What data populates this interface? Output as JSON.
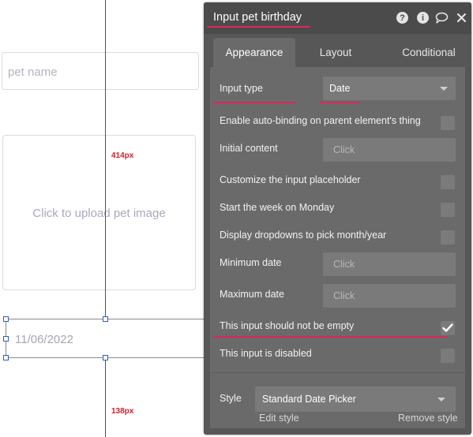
{
  "canvas": {
    "pet_name_placeholder": "pet name",
    "upload_image_text": "Click to upload pet image",
    "date_input_value": "11/06/2022",
    "guide_top_label": "414px",
    "guide_bottom_label": "138px"
  },
  "panel": {
    "title": "Input pet birthday",
    "header_icons": [
      "question-icon",
      "info-icon",
      "comment-icon",
      "close-icon"
    ],
    "tabs": [
      {
        "label": "Appearance",
        "active": true
      },
      {
        "label": "Layout",
        "active": false
      },
      {
        "label": "Conditional",
        "active": false
      }
    ],
    "input_type": {
      "label": "Input type",
      "value": "Date"
    },
    "auto_binding": {
      "label": "Enable auto-binding on parent element's thing",
      "checked": false
    },
    "initial_content": {
      "label": "Initial content",
      "placeholder": "Click"
    },
    "customize_placeholder": {
      "label": "Customize the input placeholder",
      "checked": false
    },
    "week_monday": {
      "label": "Start the week on Monday",
      "checked": false
    },
    "dropdowns_month_year": {
      "label": "Display dropdowns to pick month/year",
      "checked": false
    },
    "minimum_date": {
      "label": "Minimum date",
      "placeholder": "Click"
    },
    "maximum_date": {
      "label": "Maximum date",
      "placeholder": "Click"
    },
    "not_empty": {
      "label": "This input should not be empty",
      "checked": true
    },
    "disabled": {
      "label": "This input is disabled",
      "checked": false
    },
    "style": {
      "label": "Style",
      "value": "Standard Date Picker",
      "edit_link": "Edit style",
      "remove_link": "Remove style"
    }
  },
  "colors": {
    "accent_underline": "#e0245e",
    "guide_line": "#c0202a",
    "panel_bg": "#575757",
    "panel_body_bg": "#6a6a6a",
    "selection_handle": "#2f5dbb"
  }
}
